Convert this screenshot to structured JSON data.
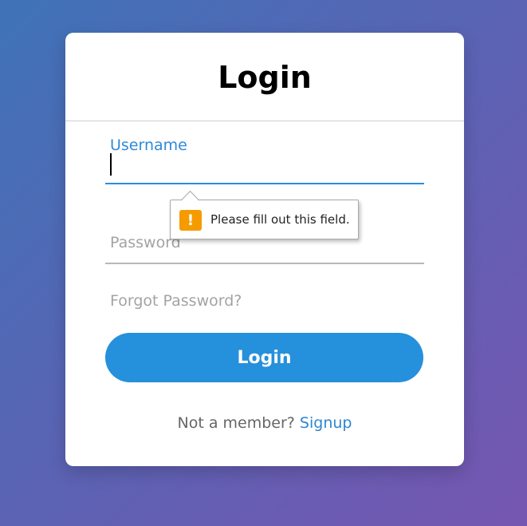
{
  "form": {
    "title": "Login",
    "username_label": "Username",
    "username_value": "",
    "password_label": "Password",
    "password_value": "",
    "forgot_label": "Forgot Password?",
    "login_button_label": "Login",
    "signup_prompt": "Not a member?",
    "signup_link_label": "Signup"
  },
  "validation_tooltip": {
    "icon": "warning-icon",
    "icon_glyph": "!",
    "message": "Please fill out this field."
  },
  "colors": {
    "accent": "#2590dc",
    "warning": "#f59b00",
    "background_start": "#3f73b8",
    "background_end": "#7656b0"
  }
}
